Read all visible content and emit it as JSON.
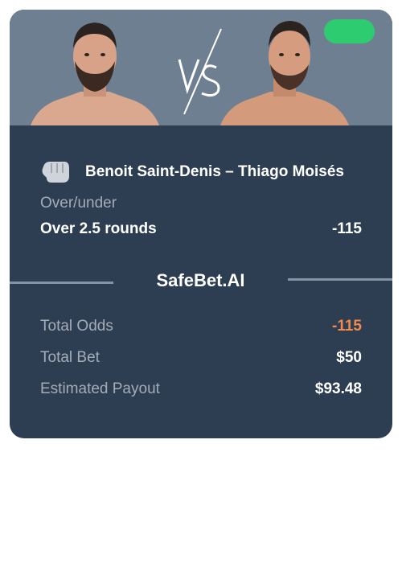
{
  "hero": {
    "left_fighter_icon": "fighter-photo",
    "right_fighter_icon": "fighter-photo",
    "vs_icon": "vs-logo",
    "status_color": "#2ecc71"
  },
  "matchup": {
    "icon": "boxing-glove-icon",
    "title": "Benoit Saint-Denis – Thiago Moisés"
  },
  "market": {
    "label": "Over/under",
    "pick": "Over 2.5 rounds",
    "odds": "-115"
  },
  "brand": {
    "name": "SafeBet.AI"
  },
  "summary": {
    "total_odds_label": "Total Odds",
    "total_odds_value": "-115",
    "total_bet_label": "Total Bet",
    "total_bet_value": "$50",
    "payout_label": "Estimated Payout",
    "payout_value": "$93.48"
  },
  "colors": {
    "card_bg": "#2e3e52",
    "hero_bg": "#6f7f92",
    "accent_orange": "#f28a4a",
    "status_green": "#2ecc71"
  }
}
